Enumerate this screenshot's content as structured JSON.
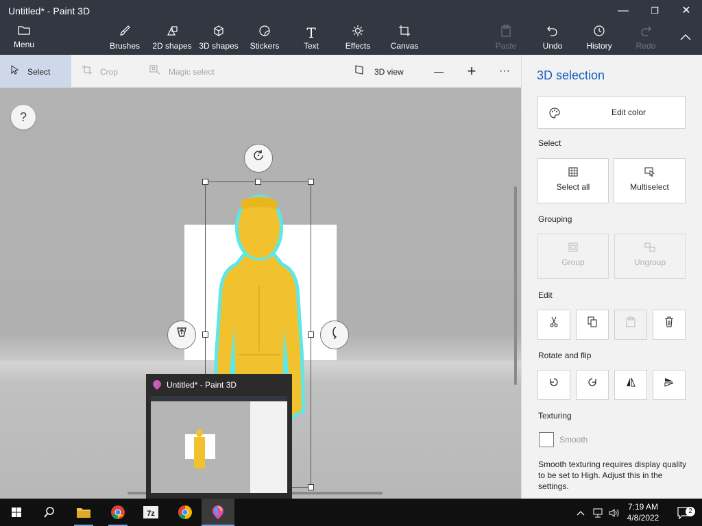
{
  "window": {
    "title": "Untitled* - Paint 3D",
    "controls": {
      "minimize": "—",
      "maximize": "❐",
      "close": "✕"
    }
  },
  "ribbon": {
    "menu": "Menu",
    "brushes": "Brushes",
    "shapes2d": "2D shapes",
    "shapes3d": "3D shapes",
    "stickers": "Stickers",
    "text": "Text",
    "effects": "Effects",
    "canvas": "Canvas",
    "paste": "Paste",
    "undo": "Undo",
    "history": "History",
    "redo": "Redo"
  },
  "toolbar": {
    "select": "Select",
    "crop": "Crop",
    "magic_select": "Magic select",
    "view3d": "3D view",
    "zoom_out": "—",
    "zoom_in": "+",
    "more": "···"
  },
  "canvas": {
    "help": "?"
  },
  "thumbnail": {
    "title": "Untitled* - Paint 3D"
  },
  "panel": {
    "title": "3D selection",
    "edit_color": "Edit color",
    "select_section": "Select",
    "select_all": "Select all",
    "multiselect": "Multiselect",
    "grouping_section": "Grouping",
    "group": "Group",
    "ungroup": "Ungroup",
    "edit_section": "Edit",
    "rotate_section": "Rotate and flip",
    "texturing_section": "Texturing",
    "smooth": "Smooth",
    "smooth_checked": false,
    "note": "Smooth texturing requires display quality to be set to High. Adjust this in the settings."
  },
  "taskbar": {
    "time": "7:19 AM",
    "date": "4/8/2022",
    "notification_count": "2",
    "apps": [
      "start-icon",
      "search-icon",
      "file-explorer-icon",
      "chrome-icon",
      "7zip-icon",
      "chrome-alt-icon",
      "paint3d-icon"
    ]
  },
  "colors": {
    "ribbon_bg": "#323741",
    "accent": "#1560bd",
    "figure": "#f2c12e",
    "selection_glow": "#5fe6e6"
  }
}
